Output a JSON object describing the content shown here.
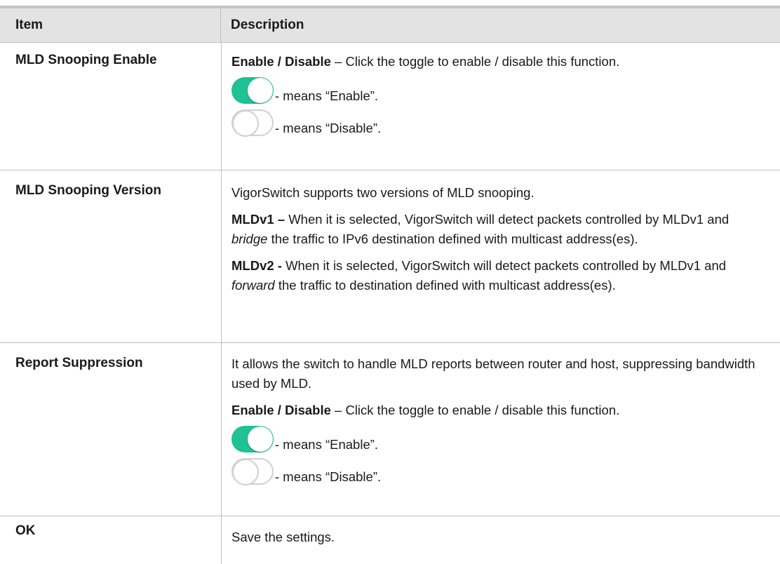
{
  "header": {
    "item": "Item",
    "description": "Description"
  },
  "rows": [
    {
      "item": "MLD Snooping Enable",
      "enable_disable_bold": "Enable / Disable",
      "enable_disable_text": " – Click the toggle to enable / disable this function.",
      "toggle_on_text": "- means “Enable”.",
      "toggle_off_text": "- means “Disable”."
    },
    {
      "item": "MLD Snooping Version",
      "intro": "VigorSwitch supports two versions of MLD snooping.",
      "v1_bold": "MLDv1 –",
      "v1_text_a": " When it is selected, VigorSwitch will detect packets controlled by MLDv1 and ",
      "v1_italic": "bridge",
      "v1_text_b": " the traffic to IPv6 destination defined with multicast address(es).",
      "v2_bold": "MLDv2 -",
      "v2_text_a": " When it is selected, VigorSwitch will detect packets controlled by MLDv1 and ",
      "v2_italic": "forward",
      "v2_text_b": " the traffic to destination defined with multicast address(es)."
    },
    {
      "item": "Report Suppression",
      "intro": "It allows the switch to handle MLD reports between router and host, suppressing bandwidth used by MLD.",
      "enable_disable_bold": "Enable / Disable",
      "enable_disable_text": " – Click the toggle to enable / disable this function.",
      "toggle_on_text": "- means “Enable”.",
      "toggle_off_text": "- means “Disable”."
    },
    {
      "item": "OK",
      "description": "Save the settings."
    }
  ],
  "colors": {
    "toggle_on": "#1fc195",
    "toggle_off_border": "#d0d0d0",
    "header_bg": "#e3e3e3"
  }
}
